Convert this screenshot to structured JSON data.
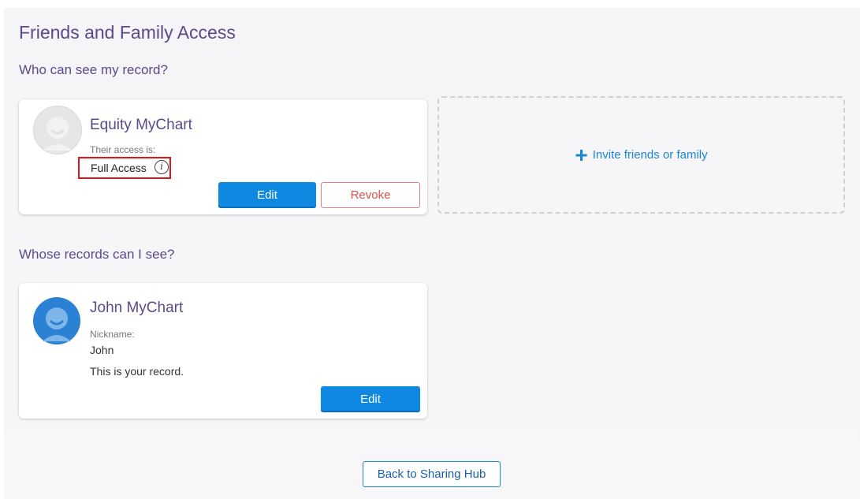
{
  "page": {
    "title": "Friends and Family Access"
  },
  "who_can_see": {
    "heading": "Who can see my record?",
    "card": {
      "name": "Equity MyChart",
      "access_label": "Their access is:",
      "access_value": "Full Access",
      "info_icon": "info-circle-icon",
      "edit_label": "Edit",
      "revoke_label": "Revoke"
    },
    "invite": {
      "icon": "plus-icon",
      "label": "Invite friends or family"
    }
  },
  "whose_records": {
    "heading": "Whose records can I see?",
    "card": {
      "name": "John MyChart",
      "nickname_label": "Nickname:",
      "nickname_value": "John",
      "note": "This is your record.",
      "edit_label": "Edit"
    }
  },
  "footer": {
    "back_label": "Back to Sharing Hub"
  },
  "colors": {
    "heading": "#5a4a8a",
    "primary": "#0e88e0",
    "danger": "#d9534f",
    "highlight_box": "#e0161e",
    "link": "#1a86d0"
  }
}
